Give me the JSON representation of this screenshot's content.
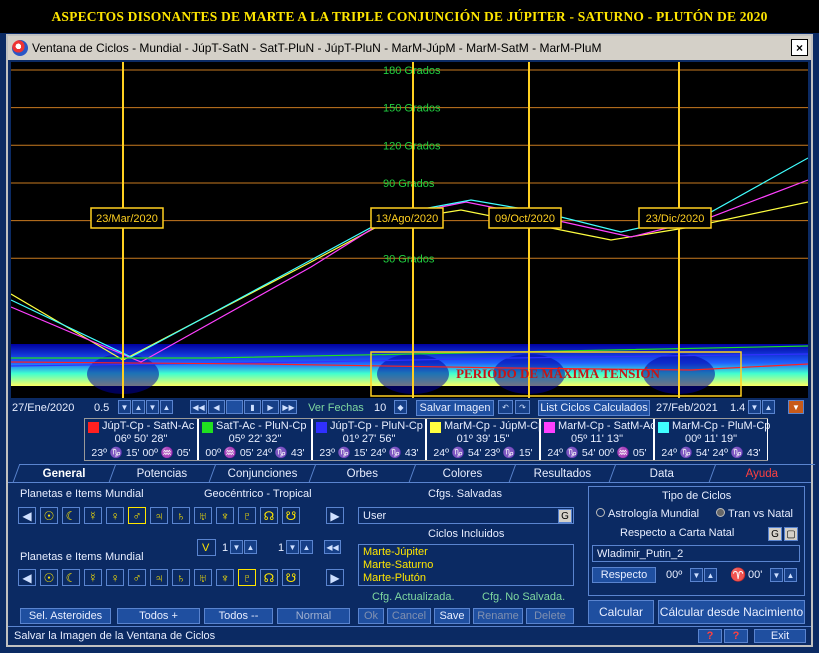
{
  "banner": "ASPECTOS DISONANTES DE MARTE A LA TRIPLE CONJUNCIÓN DE JÚPITER - SATURNO - PLUTÓN DE  2020",
  "window": {
    "title": "Ventana de Ciclos - Mundial - JúpT-SatN - SatT-PluN - JúpT-PluN - MarM-JúpM - MarM-SatM - MarM-PluM",
    "close": "×"
  },
  "chart_data": {
    "type": "line",
    "y_grid_labels": [
      "180 Grados",
      "150 Grados",
      "120 Grados",
      "90 Grados",
      "60 Grados",
      "30 Grados"
    ],
    "ylim": [
      0,
      180
    ],
    "date_markers": [
      "23/Mar/2020",
      "13/Ago/2020",
      "09/Oct/2020",
      "23/Dic/2020"
    ],
    "annotation": "PERIODO DE MÁXIMA TENSIÓN",
    "x_range": [
      "27/Ene/2020",
      "27/Feb/2021"
    ],
    "series": [
      {
        "name": "JúpT-Cp - SatN-Ac",
        "color": "#ff2020"
      },
      {
        "name": "SatT-Ac - PluN-Cp",
        "color": "#20e020"
      },
      {
        "name": "JúpT-Cp - PluN-Cp",
        "color": "#3030ff"
      },
      {
        "name": "MarM-Cp - JúpM-Cp",
        "color": "#ffff40"
      },
      {
        "name": "MarM-Cp - SatM-Ac",
        "color": "#ff40ff"
      },
      {
        "name": "MarM-Cp - PluM-Cp",
        "color": "#40ffff"
      }
    ]
  },
  "controls": {
    "start_date": "27/Ene/2020",
    "step": "0.5",
    "ver_fechas": "Ver Fechas",
    "ver_fechas_val": "10",
    "salvar_imagen": "Salvar Imagen",
    "list_ciclos": "List Ciclos Calculados",
    "end_date": "27/Feb/2021",
    "zoom": "1.4"
  },
  "legend": [
    {
      "name": "JúpT-Cp - SatN-Ac",
      "color": "#ff2020",
      "pos": "06º 50' 28\"",
      "line3": "23º ♑ 15'  00º ♒ 05'"
    },
    {
      "name": "SatT-Ac - PluN-Cp",
      "color": "#20e020",
      "pos": "05º 22' 32\"",
      "line3": "00º ♒ 05' 24º ♑ 43'"
    },
    {
      "name": "JúpT-Cp - PluN-Cp",
      "color": "#3030ff",
      "pos": "01º 27' 56\"",
      "line3": "23º ♑ 15' 24º ♑ 43'"
    },
    {
      "name": "MarM-Cp - JúpM-Cp",
      "color": "#ffff40",
      "pos": "01º 39' 15\"",
      "line3": "24º ♑ 54'  23º ♑ 15'"
    },
    {
      "name": "MarM-Cp - SatM-Ac",
      "color": "#ff40ff",
      "pos": "05º 11' 13\"",
      "line3": "24º ♑ 54'  00º ♒ 05'"
    },
    {
      "name": "MarM-Cp - PluM-Cp",
      "color": "#40ffff",
      "pos": "00º 11' 19\"",
      "line3": "24º ♑ 54'  24º ♑ 43'"
    }
  ],
  "tabs": [
    "General",
    "Potencias",
    "Conjunciones",
    "Orbes",
    "Colores",
    "Resultados",
    "Data",
    "Ayuda"
  ],
  "general": {
    "planetas_mundial_1": "Planetas e Items Mundial",
    "geo_tropical": "Geocéntrico - Tropical",
    "planetas_mundial_2": "Planetas e Items Mundial",
    "planet_glyphs": [
      "☉",
      "☾",
      "☿",
      "♀",
      "♂",
      "♃",
      "♄",
      "♅",
      "♆",
      "♇",
      "☊",
      "☋"
    ],
    "v_label": "V",
    "v_val1": "1",
    "v_val2": "1",
    "sel_asteroides": "Sel. Asteroides",
    "todos_plus": "Todos +",
    "todos_minus": "Todos --",
    "normal": "Normal",
    "cfg_salvadas": "Cfgs. Salvadas",
    "user_field": "User",
    "g": "G",
    "ciclos_incluidos": "Ciclos Incluidos",
    "ciclos": [
      "Marte-Júpiter",
      "Marte-Saturno",
      "Marte-Plutón"
    ],
    "cfg_actualizada": "Cfg. Actualizada.",
    "cfg_no_salvada": "Cfg. No Salvada.",
    "ok": "Ok",
    "cancel": "Cancel",
    "save": "Save",
    "rename": "Rename",
    "delete": "Delete",
    "tipo_ciclos": "Tipo de Ciclos",
    "astro_mundial": "Astrología Mundial",
    "tran_vs_natal": "Tran vs Natal",
    "respecto_carta": "Respecto a Carta Natal",
    "carta": "Wladimir_Putin_2",
    "respecto_btn": "Respecto",
    "deg1": "00º",
    "sign": "♈",
    "deg2": "00'",
    "calcular": "Calcular",
    "calcular_nac": "Cálcular desde Nacimiento"
  },
  "status": {
    "text": "Salvar la Imagen de la Ventana de Ciclos",
    "q1": "?",
    "q2": "?",
    "exit": "Exit"
  }
}
